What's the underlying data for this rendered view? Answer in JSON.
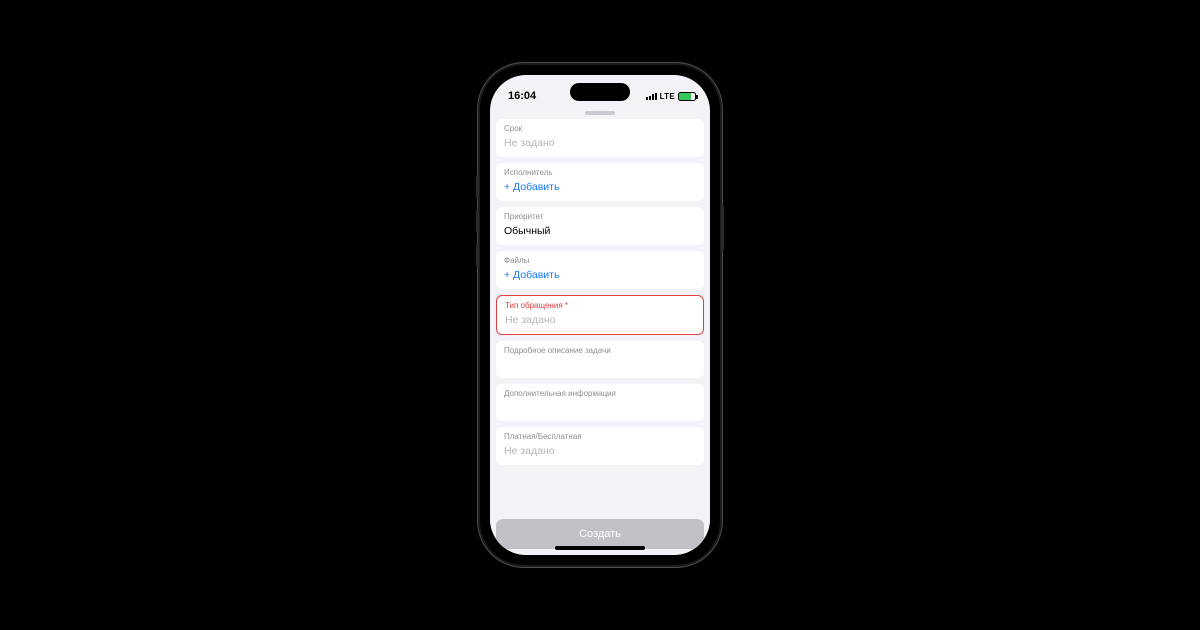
{
  "status": {
    "time": "16:04",
    "network": "LTE"
  },
  "fields": {
    "deadline": {
      "label": "Срок",
      "value": "Не задано",
      "placeholder": true
    },
    "assignee": {
      "label": "Исполнитель",
      "link": "+ Добавить"
    },
    "priority": {
      "label": "Приоритет",
      "value": "Обычный",
      "placeholder": false
    },
    "files": {
      "label": "Файлы",
      "link": "+ Добавить"
    },
    "req_type": {
      "label": "Тип обращения *",
      "value": "Не задано",
      "placeholder": true
    },
    "desc": {
      "label": "Подробное описание задачи",
      "value": ""
    },
    "extra": {
      "label": "Дополнительная информация",
      "value": ""
    },
    "paid": {
      "label": "Платная/Бесплатная",
      "value": "Не задано",
      "placeholder": true
    }
  },
  "actions": {
    "create": "Создать"
  }
}
